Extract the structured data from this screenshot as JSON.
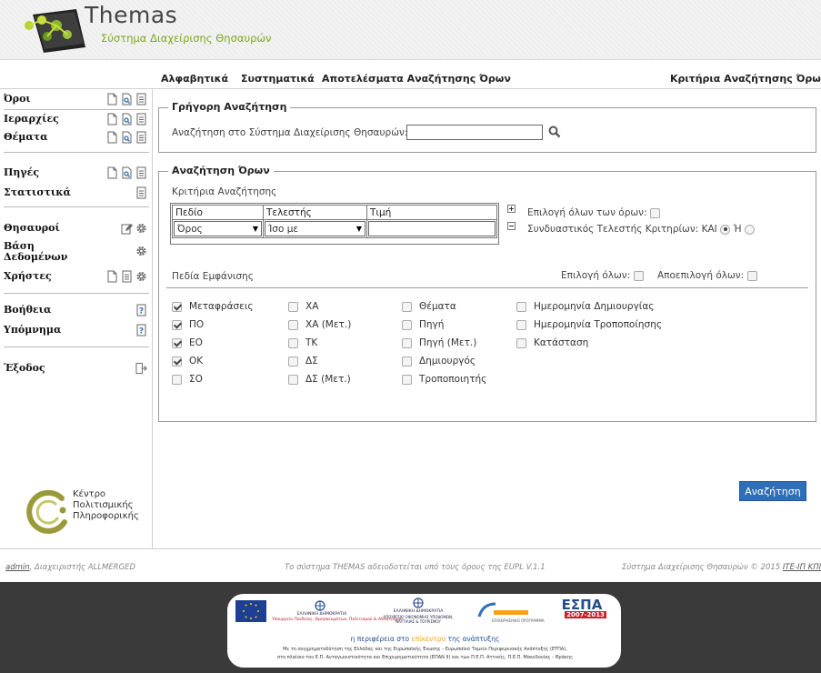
{
  "app": {
    "title": "Themas",
    "subtitle": "Σύστημα Διαχείρισης Θησαυρών"
  },
  "topnav": {
    "items": [
      "Αλφαβητικά",
      "Συστηματικά",
      "Αποτελέσματα Αναζήτησης Όρων"
    ],
    "right": "Κριτήρια Αναζήτησης Όρων"
  },
  "sidebar": {
    "items": [
      {
        "label": "Όροι",
        "icons": [
          "new-icon",
          "search-doc-icon",
          "list-icon"
        ]
      },
      {
        "label": "Ιεραρχίες",
        "icons": [
          "new-icon",
          "search-doc-icon",
          "list-icon"
        ]
      },
      {
        "label": "Θέματα",
        "icons": [
          "new-icon",
          "search-doc-icon",
          "list-icon"
        ]
      },
      {
        "label": "Πηγές",
        "icons": [
          "new-icon",
          "search-doc-icon",
          "list-icon"
        ]
      },
      {
        "label": "Στατιστικά",
        "icons": [
          "list-icon"
        ]
      },
      {
        "label": "Θησαυροί",
        "icons": [
          "edit-icon",
          "gear-icon"
        ]
      },
      {
        "label": "Βάση",
        "label2": "Δεδομένων",
        "icons": [
          "gear-icon"
        ]
      },
      {
        "label": "Χρήστες",
        "icons": [
          "new-icon",
          "list-icon",
          "gear-icon"
        ]
      },
      {
        "label": "Βοήθεια",
        "icons": [
          "help-icon"
        ]
      },
      {
        "label": "Υπόμνημα",
        "icons": [
          "help-icon"
        ]
      },
      {
        "label": "Έξοδος",
        "icons": [
          "exit-icon"
        ]
      }
    ],
    "org": {
      "line1": "Κέντρο",
      "line2": "Πολιτισμικής",
      "line3": "Πληροφορικής"
    }
  },
  "quick_search": {
    "legend": "Γρήγορη Αναζήτηση",
    "label": "Αναζήτηση στο Σύστημα Διαχείρισης Θησαυρών:",
    "value": ""
  },
  "term_search": {
    "legend": "Αναζήτηση Όρων",
    "criteria_label": "Κριτήρια Αναζήτησης",
    "columns": [
      "Πεδίο",
      "Τελεστής",
      "Τιμή"
    ],
    "row": {
      "field": "Όρος",
      "operator": "Ίσο με",
      "value": ""
    },
    "select_all_terms": "Επιλογή όλων των όρων:",
    "connector_label": "Συνδυαστικός Τελεστής Κριτηρίων:",
    "connector_and": "ΚΑΙ",
    "connector_or": "Ή",
    "connector_selected": "ΚΑΙ",
    "display_fields_label": "Πεδία Εμφάνισης",
    "select_all": "Επιλογή όλων:",
    "deselect_all": "Αποεπιλογή όλων:",
    "fields": [
      [
        {
          "label": "Μεταφράσεις",
          "checked": true
        },
        {
          "label": "ΠΟ",
          "checked": true
        },
        {
          "label": "ΕΟ",
          "checked": true
        },
        {
          "label": "ΟΚ",
          "checked": true
        },
        {
          "label": "ΣΟ",
          "checked": false
        }
      ],
      [
        {
          "label": "ΧΑ",
          "checked": false
        },
        {
          "label": "ΧΑ (Μετ.)",
          "checked": false
        },
        {
          "label": "ΤΚ",
          "checked": false
        },
        {
          "label": "ΔΣ",
          "checked": false
        },
        {
          "label": "ΔΣ (Μετ.)",
          "checked": false
        }
      ],
      [
        {
          "label": "Θέματα",
          "checked": false
        },
        {
          "label": "Πηγή",
          "checked": false
        },
        {
          "label": "Πηγή (Μετ.)",
          "checked": false
        },
        {
          "label": "Δημιουργός",
          "checked": false
        },
        {
          "label": "Τροποποιητής",
          "checked": false
        }
      ],
      [
        {
          "label": "Ημερομηνία Δημιουργίας",
          "checked": false
        },
        {
          "label": "Ημερομηνία Τροποποίησης",
          "checked": false
        },
        {
          "label": "Κατάσταση",
          "checked": false
        }
      ]
    ],
    "search_button": "Αναζήτηση"
  },
  "status": {
    "user": "admin",
    "role": ", Διαχειριστής ALLMERGED",
    "license": "Το σύστημα THEMAS αδειοδοτείται υπό τους όρους της EUPL V.1.1",
    "copyright": "Σύστημα Διαχείρισης Θησαυρών © 2015",
    "copyright_link": "ITE-ΙΠ ΚΠΠ"
  },
  "footer": {
    "gov1": "ΕΛΛΗΝΙΚΗ ΔΗΜΟΚΡΑΤΙΑ",
    "ministry1": "Υπουργείο Παιδείας, Θρησκευμάτων, Πολιτισμού & Αθλητισμού",
    "gov2": "ΕΛΛΗΝΙΚΗ ΔΗΜΟΚΡΑΤΙΑ",
    "ministry2": "ΥΠΟΥΡΓΕΙΟ ΟΙΚΟΝΟΜΙΑΣ ΥΠΟΔΟΜΩΝ, ΝΑΥΤΙΛΙΑΣ & ΤΟΥΡΙΣΜΟΥ",
    "programme": "ΕΠΙΧΕΙΡΗΣΙΑΚΟ ΠΡΟΓΡΑΜΜΑ",
    "espa": "ΕΣΠΑ",
    "espa_years": "2007-2013",
    "tagline_a": "η περιφέρεια στο ",
    "tagline_b": "επίκεντρο",
    "tagline_c": " της ανάπτυξης",
    "cofund1": "Με τη συγχρηματοδότηση της Ελλάδας και της Ευρωπαϊκής Ένωσης - Ευρωπαϊκό Ταμείο Περιφερειακής Ανάπτυξης (ΕΤΠΑ),",
    "cofund2": "στο πλαίσιο του Ε.Π. Ανταγωνιστικότητα και Επιχειρηματικότητα (ΕΠΑΝ ΙΙ) και των Π.Ε.Π. Αττικής, Π.Ε.Π. Μακεδονίας - Θράκης"
  },
  "colors": {
    "accent": "#2e6fb7",
    "brand_green": "#7aa81d",
    "footer_bg": "#3a3a3a"
  }
}
